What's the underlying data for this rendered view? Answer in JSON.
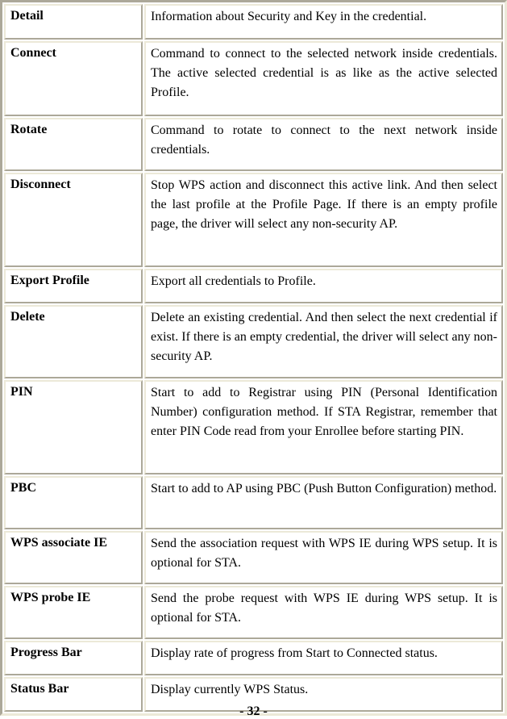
{
  "table": {
    "rows": [
      {
        "term": "Detail",
        "description": "Information about Security and Key in the credential."
      },
      {
        "term": "Connect",
        "description": "Command to connect to the selected network inside credentials. The active selected credential is as like as the active selected Profile."
      },
      {
        "term": "Rotate",
        "description": "Command to rotate to connect to the next network inside credentials."
      },
      {
        "term": "Disconnect",
        "description": "Stop WPS action and disconnect this active link. And then select the last profile at the Profile Page. If there is an empty profile page, the driver will select any non-security AP."
      },
      {
        "term": "Export Profile",
        "description": "Export all credentials to Profile."
      },
      {
        "term": "Delete",
        "description": "Delete an existing credential. And then select the next credential if exist. If there is an empty credential, the driver will select any non-security AP."
      },
      {
        "term": "PIN",
        "description": "Start to add to Registrar using PIN (Personal Identification Number) configuration method. If STA Registrar, remember that enter PIN Code read from your Enrollee before starting PIN."
      },
      {
        "term": "PBC",
        "description": "Start to add to AP using PBC (Push Button Configuration) method."
      },
      {
        "term": "WPS associate IE",
        "description": "Send the association request with WPS IE during WPS setup. It is optional for STA."
      },
      {
        "term": "WPS probe IE",
        "description": "Send the probe request with WPS IE during WPS setup. It is optional for STA."
      },
      {
        "term": "Progress Bar",
        "description": "Display rate of progress from Start to Connected status."
      },
      {
        "term": "Status Bar",
        "description": "Display currently WPS Status."
      }
    ]
  },
  "footer": {
    "page_number": "- 32 -"
  }
}
